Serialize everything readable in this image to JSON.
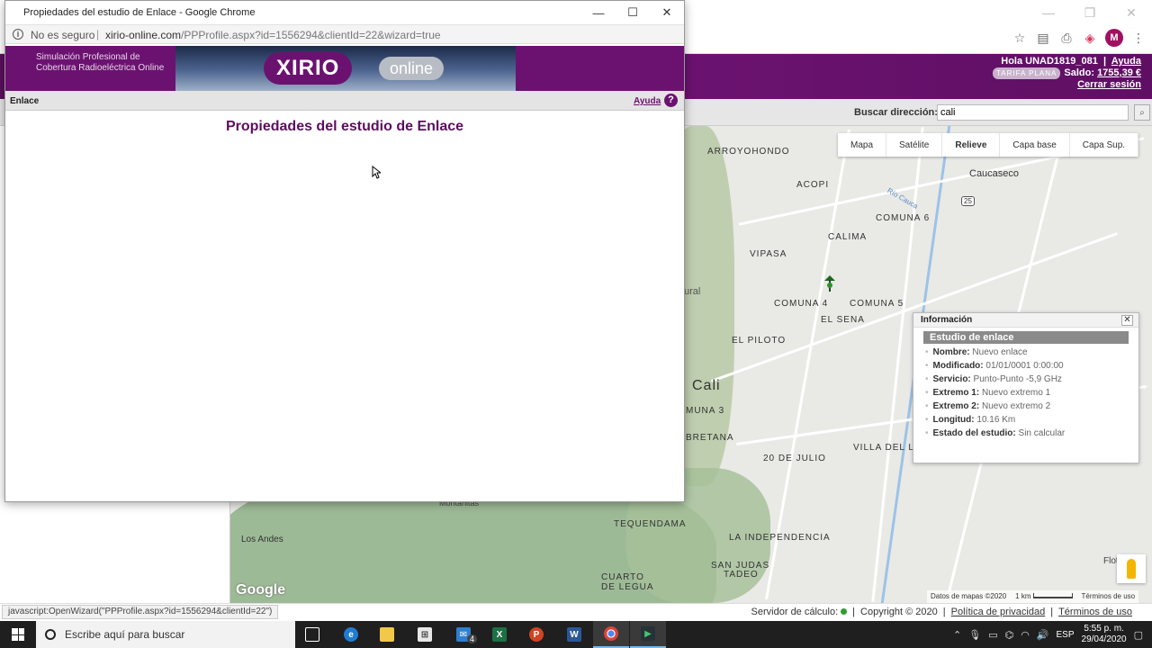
{
  "popup": {
    "window_title": "Propiedades del estudio de Enlace - Google Chrome",
    "security_label": "No es seguro",
    "url_host": "xirio-online.com",
    "url_path": "/PPProfile.aspx?id=1556294&clientId=22&wizard=true",
    "banner_tagline": "Simulación Profesional de Cobertura Radioeléctrica Online",
    "logo_main": "XIRIO",
    "logo_secondary": "online",
    "section_label": "Enlace",
    "help_label": "Ayuda",
    "heading": "Propiedades del estudio de Enlace"
  },
  "header": {
    "greeting": "Hola UNAD1819_081",
    "help_label": "Ayuda",
    "tariff_badge": "TARIFA PLANA",
    "balance_label": "Saldo:",
    "balance_value": "1755,39 €",
    "logout_label": "Cerrar sesión",
    "profile_initial": "M"
  },
  "search": {
    "label": "Buscar dirección:",
    "value": "cali"
  },
  "map": {
    "types": [
      "Mapa",
      "Satélite",
      "Relieve",
      "Capa base",
      "Capa Sup."
    ],
    "active_type": "Relieve",
    "labels": {
      "arroyohondo": "ARROYOHONDO",
      "caucaseco": "Caucaseco",
      "acopi": "ACOPI",
      "comuna6": "COMUNA 6",
      "calima": "CALIMA",
      "vipasa": "VIPASA",
      "comuna4": "COMUNA 4",
      "comuna5": "COMUNA 5",
      "elsena": "EL SENA",
      "elpiloto": "EL PILOTO",
      "cali": "Cali",
      "comuna3": "MUNA 3",
      "bretana": "BRETANA",
      "villadelago": "VILLA DEL LA",
      "julio20": "20 DE JULIO",
      "tequendama": "TEQUENDAMA",
      "laindependencia": "LA INDEPENDENCIA",
      "losandes": "Los Andes",
      "montanitas": "Montañitas",
      "sanjudas": "SAN JUDAS",
      "tadeo": "TADEO",
      "cuarto": "CUARTO",
      "legua": "DE LEGUA",
      "rural": "ural",
      "rio_cauca": "Río Cauca",
      "route25": "25",
      "flot": "Flot"
    },
    "footer_data": "Datos de mapas ©2020",
    "footer_scale": "1 km",
    "footer_terms": "Términos de uso",
    "google": "Google"
  },
  "info_panel": {
    "title": "Información",
    "section": "Estudio de enlace",
    "rows": [
      {
        "key": "Nombre:",
        "value": "Nuevo enlace"
      },
      {
        "key": "Modificado:",
        "value": "01/01/0001 0:00:00"
      },
      {
        "key": "Servicio:",
        "value": "Punto-Punto -5,9 GHz"
      },
      {
        "key": "Extremo 1:",
        "value": "Nuevo extremo 1"
      },
      {
        "key": "Extremo 2:",
        "value": "Nuevo extremo 2"
      },
      {
        "key": "Longitud:",
        "value": "10.16 Km"
      },
      {
        "key": "Estado del estudio:",
        "value": "Sin calcular"
      }
    ]
  },
  "status": {
    "link_text": "javascript:OpenWizard(\"PPProfile.aspx?id=1556294&clientId=22\")",
    "server_label": "Servidor de cálculo:",
    "copyright": "Copyright © 2020",
    "privacy": "Política de privacidad",
    "terms": "Términos de uso"
  },
  "taskbar": {
    "search_placeholder": "Escribe aquí para buscar",
    "mail_badge": "4",
    "language": "ESP",
    "time": "5:55 p. m.",
    "date": "29/04/2020"
  },
  "colors": {
    "brand": "#6b1270",
    "brand_dark": "#5b0f5e",
    "server_ok": "#2ca02c"
  }
}
